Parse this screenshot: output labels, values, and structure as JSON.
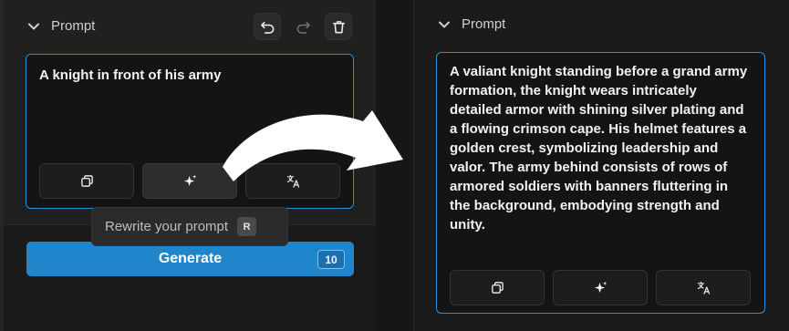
{
  "left": {
    "header": {
      "title": "Prompt"
    },
    "header_buttons": {
      "undo": "undo-icon",
      "redo": "redo-icon",
      "delete": "trash-icon"
    },
    "prompt_value": "A knight in front of his army",
    "tools": [
      "copy-icon",
      "sparkle-icon",
      "translate-icon"
    ],
    "tooltip": {
      "text": "Rewrite your prompt",
      "key": "R"
    },
    "generate": {
      "label": "Generate",
      "count": "10"
    }
  },
  "right": {
    "header": {
      "title": "Prompt"
    },
    "prompt_value": "A valiant knight standing before a grand army formation, the knight wears intricately detailed armor with shining silver plating and a flowing crimson cape. His helmet features a golden crest, symbolizing leadership and valor. The army behind consists of rows of armored soldiers with banners fluttering in the background, embodying strength and unity.",
    "tools": [
      "copy-icon",
      "sparkle-icon",
      "translate-icon"
    ]
  },
  "colors": {
    "accent": "#2f8fd6",
    "generate": "#1f86cc",
    "background": "#161616"
  }
}
